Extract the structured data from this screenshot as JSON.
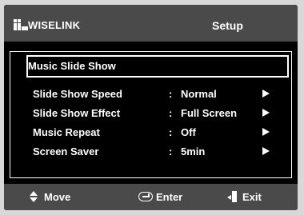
{
  "header": {
    "brand": "WISELINK",
    "title": "Setup"
  },
  "menu": {
    "selected_index": 0,
    "items": [
      {
        "label": "Music Slide Show",
        "value": "",
        "has_arrow": false
      },
      {
        "label": "Slide Show Speed",
        "value": "Normal",
        "has_arrow": true
      },
      {
        "label": "Slide Show Effect",
        "value": "Full Screen",
        "has_arrow": true
      },
      {
        "label": "Music Repeat",
        "value": "Off",
        "has_arrow": true
      },
      {
        "label": "Screen Saver",
        "value": "5min",
        "has_arrow": true
      }
    ],
    "colon": ":"
  },
  "footer": {
    "move_label": "Move",
    "enter_label": "Enter",
    "exit_label": "Exit"
  },
  "icons": {
    "move": "up-down-arrows-icon",
    "enter": "enter-icon",
    "exit": "exit-door-icon",
    "row_arrow": "right-triangle-icon"
  }
}
